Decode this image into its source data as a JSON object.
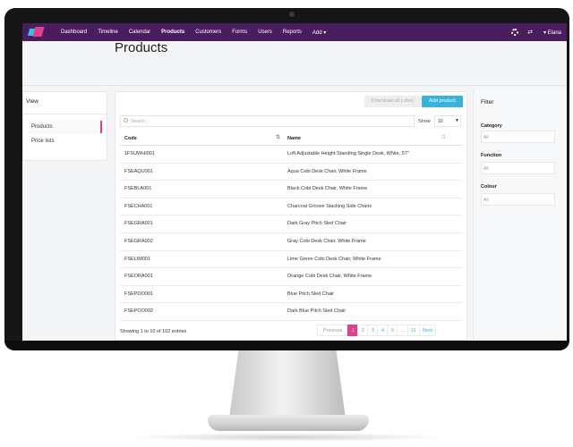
{
  "navbar": {
    "items": [
      {
        "label": "Dashboard"
      },
      {
        "label": "Timeline"
      },
      {
        "label": "Calendar"
      },
      {
        "label": "Products"
      },
      {
        "label": "Customers"
      },
      {
        "label": "Forms"
      },
      {
        "label": "Users"
      },
      {
        "label": "Reports"
      },
      {
        "label": "Add ▾"
      }
    ],
    "active": "Products",
    "user": "▾ Elana",
    "bg_color": "#4a1e5e"
  },
  "page": {
    "title": "Products"
  },
  "view": {
    "title": "View",
    "items": [
      {
        "label": "Products"
      },
      {
        "label": "Price lists"
      }
    ]
  },
  "toolbar": {
    "download_label": "Download all (.xlsx)",
    "add_label": "Add product"
  },
  "search": {
    "placeholder": "Search..."
  },
  "length": {
    "label": "Show",
    "value": "10"
  },
  "table": {
    "columns": [
      "Code",
      "Name"
    ],
    "rows": [
      {
        "code": "1FSUWHI001",
        "name": "Loft Adjustable Height Standing Single Desk, White, 57\""
      },
      {
        "code": "FSEAQU001",
        "name": "Aqua Cobi Desk Chair, White Frame"
      },
      {
        "code": "FSEBLA001",
        "name": "Black Cobi Desk Chair, White Frame"
      },
      {
        "code": "FSECHA001",
        "name": "Charcoal Groove Stacking Side Chairs"
      },
      {
        "code": "FSEGRA001",
        "name": "Dark Gray Pitch Sled Chair"
      },
      {
        "code": "FSEGRA002",
        "name": "Gray Cobi Desk Chair, White Frame"
      },
      {
        "code": "FSELIM001",
        "name": "Lime Green Cobi Desk Chair, White Frame"
      },
      {
        "code": "FSEORA001",
        "name": "Orange Cobi Desk Chair, White Frame"
      },
      {
        "code": "FSEPOO001",
        "name": "Blue Pitch Sled Chair"
      },
      {
        "code": "FSEPOO002",
        "name": "Dark Blue Pitch Sled Chair"
      }
    ],
    "info": "Showing 1 to 10 of 102 entries"
  },
  "pagination": {
    "previous": "Previous",
    "pages": [
      "1",
      "2",
      "3",
      "4",
      "5",
      "...",
      "11"
    ],
    "active": "1",
    "next": "Next"
  },
  "filter": {
    "title": "Filter",
    "groups": [
      {
        "label": "Category",
        "value": "All"
      },
      {
        "label": "Function",
        "value": "All"
      },
      {
        "label": "Colour",
        "value": "All"
      }
    ]
  },
  "colors": {
    "accent": "#e83c8c",
    "primary": "#35b4e0"
  }
}
